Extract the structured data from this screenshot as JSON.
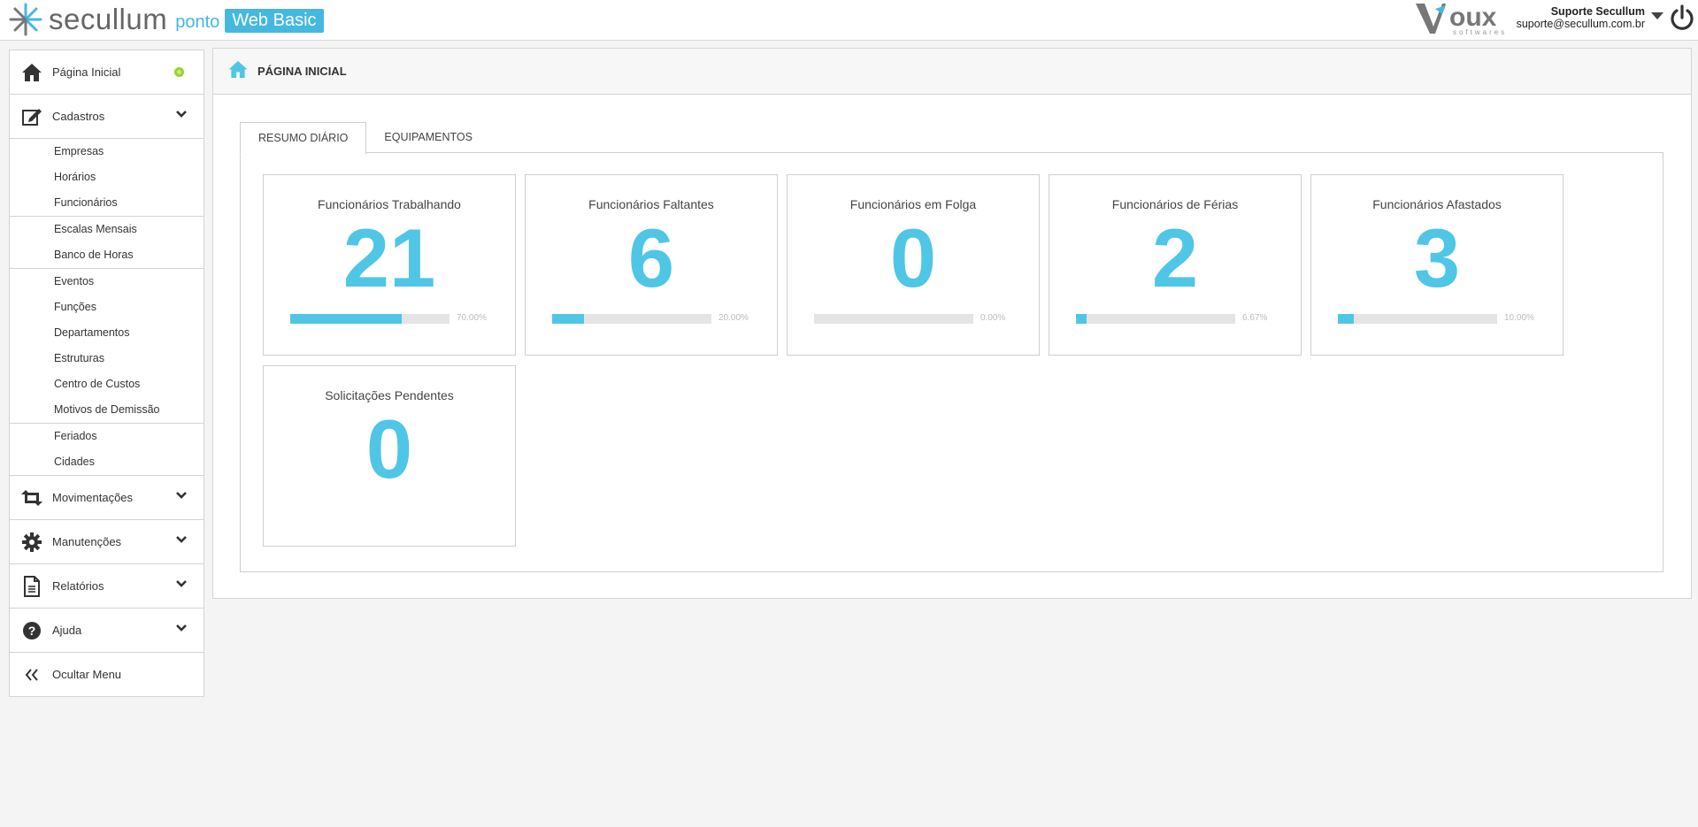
{
  "header": {
    "brand_name": "secullum",
    "brand_ponto": "ponto",
    "brand_badge": "Web Basic",
    "voux_logo": "Voux softwares",
    "user_name": "Suporte Secullum",
    "user_email": "suporte@secullum.com.br",
    "icons": {
      "caret": "caret-down-icon",
      "power": "power-icon"
    }
  },
  "sidebar": {
    "home": {
      "label": "Página Inicial",
      "icon": "home-icon"
    },
    "cadastros": {
      "label": "Cadastros",
      "icon": "edit-icon",
      "items": [
        {
          "label": "Empresas"
        },
        {
          "label": "Horários"
        },
        {
          "label": "Funcionários"
        },
        {
          "label": "Escalas Mensais"
        },
        {
          "label": "Banco de Horas"
        },
        {
          "label": "Eventos"
        },
        {
          "label": "Funções"
        },
        {
          "label": "Departamentos"
        },
        {
          "label": "Estruturas"
        },
        {
          "label": "Centro de Custos"
        },
        {
          "label": "Motivos de Demissão"
        },
        {
          "label": "Feriados"
        },
        {
          "label": "Cidades"
        }
      ]
    },
    "movimentacoes": {
      "label": "Movimentações",
      "icon": "retweet-icon"
    },
    "manutencoes": {
      "label": "Manutenções",
      "icon": "gear-icon"
    },
    "relatorios": {
      "label": "Relatórios",
      "icon": "document-icon"
    },
    "ajuda": {
      "label": "Ajuda",
      "icon": "question-icon"
    },
    "ocultar": {
      "label": "Ocultar Menu",
      "icon": "double-chevron-left-icon"
    }
  },
  "main": {
    "title": "PÁGINA INICIAL",
    "tabs": [
      {
        "label": "RESUMO DIÁRIO",
        "active": true
      },
      {
        "label": "EQUIPAMENTOS",
        "active": false
      }
    ],
    "cards": [
      {
        "title": "Funcionários Trabalhando",
        "value": "21",
        "percent": 70.0,
        "percent_label": "70.00%"
      },
      {
        "title": "Funcionários Faltantes",
        "value": "6",
        "percent": 20.0,
        "percent_label": "20.00%"
      },
      {
        "title": "Funcionários em Folga",
        "value": "0",
        "percent": 0.0,
        "percent_label": "0.00%"
      },
      {
        "title": "Funcionários de Férias",
        "value": "2",
        "percent": 6.67,
        "percent_label": "6.67%"
      },
      {
        "title": "Funcionários Afastados",
        "value": "3",
        "percent": 10.0,
        "percent_label": "10.00%"
      },
      {
        "title": "Solicitações Pendentes",
        "value": "0"
      }
    ]
  },
  "colors": {
    "accent": "#4fc6e6",
    "brand_badge": "#45b8e0",
    "status_dot": "#9bd23a"
  }
}
